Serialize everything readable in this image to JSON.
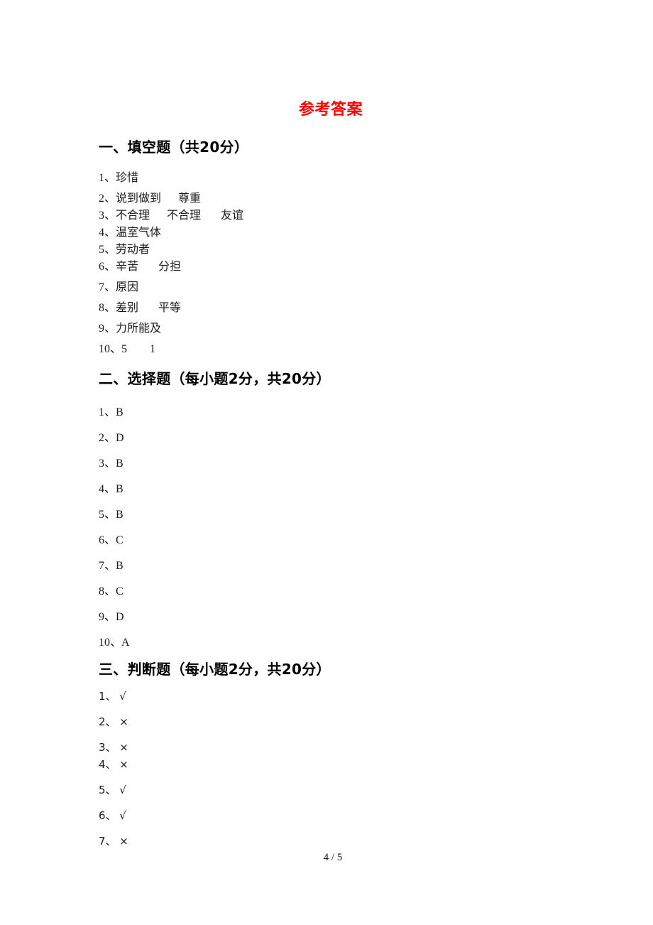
{
  "document": {
    "title": "参考答案",
    "title_color": "#FF0000",
    "background_color": "#FFFFFF",
    "text_color": "#000000",
    "footer": "4 / 5",
    "page_number": 4,
    "page_total": 5
  },
  "sections": [
    {
      "heading": "一、填空题（共20分）",
      "answers": [
        "1、珍惜",
        "2、说到做到      尊重",
        "3、不合理      不合理       友谊",
        "4、温室气体",
        "5、劳动者",
        "6、辛苦       分担",
        "7、原因",
        "8、差别       平等",
        "9、力所能及",
        "10、5        1"
      ]
    },
    {
      "heading": "二、选择题（每小题2分，共20分）",
      "answers": [
        "1、B",
        "2、D",
        "3、B",
        "4、B",
        "5、B",
        "6、C",
        "7、B",
        "8、C",
        "9、D",
        "10、A"
      ]
    },
    {
      "heading": "三、判断题（每小题2分，共20分）",
      "answers": [
        "1、 √",
        "2、 ×",
        "3、 ×",
        "4、 ×",
        "5、 √",
        "6、 √",
        "7、 ×"
      ]
    }
  ]
}
